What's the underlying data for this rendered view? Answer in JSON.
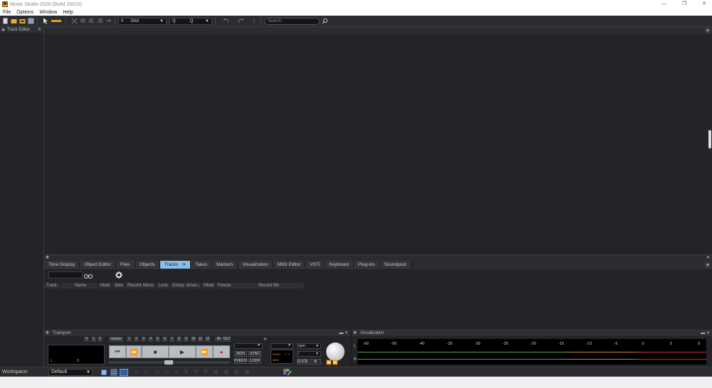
{
  "window": {
    "title": "Music Studio 2026 (Build 26015)",
    "app_icon_letter": "M",
    "controls": {
      "minimize": "—",
      "restore": "❐",
      "close": "✕"
    }
  },
  "menu": [
    "File",
    "Options",
    "Window",
    "Help"
  ],
  "toolbar": {
    "grid_symbol": "#",
    "grid_label": "Grid",
    "quantize_symbol": "Q",
    "quantize_label": "Q",
    "search_placeholder": "Search"
  },
  "left_panel": {
    "title": "Track Editor"
  },
  "manager": {
    "tabs": [
      "Time Display",
      "Object Editor",
      "Files",
      "Objects",
      "Tracks",
      "Takes",
      "Markers",
      "Visualization",
      "MIDI Editor",
      "VSTi",
      "Keyboard",
      "Plug-ins",
      "Soundpool"
    ],
    "active_tab": "Tracks",
    "table_columns": [
      "Track",
      "Name",
      "Mute",
      "Solo",
      "Record",
      "Mono",
      "Lock",
      "Group",
      "Arran...",
      "Mixer",
      "Freeze",
      "Record file"
    ]
  },
  "transport": {
    "title": "Transport",
    "marker_label": "marker",
    "marker_numbers": [
      "1",
      "2",
      "3",
      "4",
      "5",
      "6",
      "7",
      "8",
      "9",
      "10",
      "11",
      "12"
    ],
    "in_label": "IN",
    "out_label": "OUT",
    "top_numbers": [
      "1",
      "2"
    ],
    "lcd_left": "L",
    "lcd_right": "8",
    "buttons": {
      "mon": "MON",
      "sync": "SYNC",
      "punch": "PUNCH",
      "loop": "LOOP",
      "click": "CLICK"
    },
    "bpm_label": "bpm",
    "sig_label": "/",
    "sync_labels": [
      "SYNC",
      "MIDI"
    ]
  },
  "visualization": {
    "title": "Visualization",
    "scale": [
      "-60",
      "-50",
      "-40",
      "-35",
      "-30",
      "-25",
      "-20",
      "-15",
      "-10",
      "-5",
      "0",
      "5",
      "9"
    ],
    "channel_labels": [
      "L",
      "R"
    ]
  },
  "statusbar": {
    "workspace_label": "Workspace:",
    "workspace_value": "Default"
  },
  "colors": {
    "accent_tab": "#8bbde8",
    "record": "#e02020",
    "meter_green": "#5aa23a",
    "meter_orange": "#d88a1a",
    "meter_red": "#d02a2a"
  }
}
